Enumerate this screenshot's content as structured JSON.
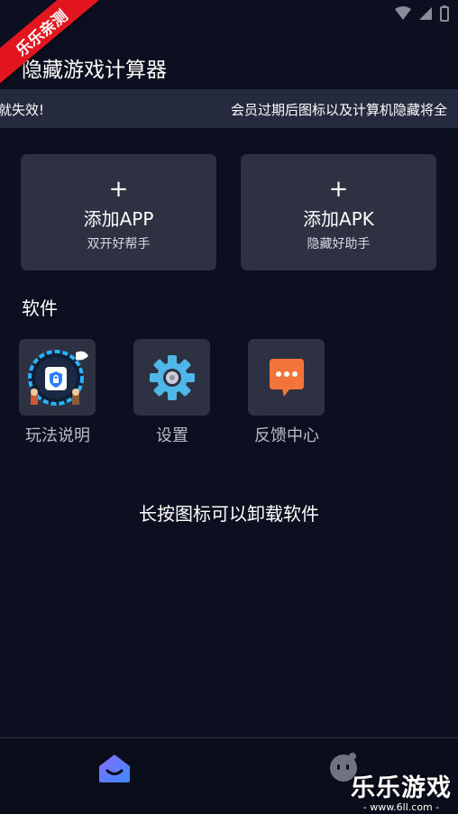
{
  "ribbon": {
    "text": "乐乐亲测"
  },
  "app": {
    "title": "隐藏游戏计算器"
  },
  "notice": {
    "left_text": "就失效!",
    "right_text": "会员过期后图标以及计算机隐藏将全"
  },
  "cards": [
    {
      "plus": "+",
      "title": "添加APP",
      "subtitle": "双开好帮手"
    },
    {
      "plus": "+",
      "title": "添加APK",
      "subtitle": "隐藏好助手"
    }
  ],
  "section": {
    "title": "软件"
  },
  "apps": [
    {
      "label": "玩法说明",
      "icon": "guide-icon"
    },
    {
      "label": "设置",
      "icon": "gear-icon"
    },
    {
      "label": "反馈中心",
      "icon": "chat-bubble-icon"
    }
  ],
  "hint": "长按图标可以卸载软件",
  "watermark": {
    "text": "乐乐游戏",
    "url": "- www.6ll.com -"
  },
  "colors": {
    "background": "#0c0f1f",
    "card": "#2d3142",
    "notice": "#252a3e",
    "ribbon": "#e3161f",
    "nav_active": "#6a5cff",
    "feedback_icon": "#f3743a",
    "gear_icon": "#4fb6e8"
  }
}
